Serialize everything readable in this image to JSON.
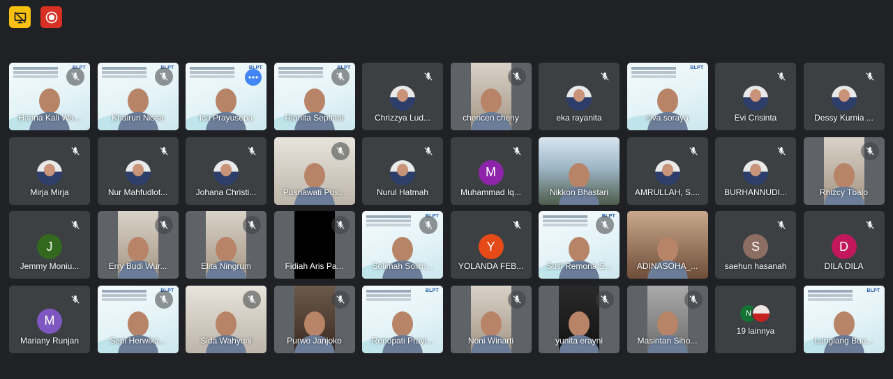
{
  "toolbar": {
    "present_icon": "presentation-off-icon",
    "record_icon": "recording-icon",
    "present_color": "#f9c00f",
    "record_color": "#d93025"
  },
  "colors": {
    "background": "#202124",
    "tile": "#3c4043",
    "active_border": "#8ab4f8"
  },
  "participants": [
    {
      "name": "Hanna Kali Wa...",
      "kind": "slide",
      "muted": true
    },
    {
      "name": "Khairun Nissa",
      "kind": "slide",
      "muted": true
    },
    {
      "name": "Ica Prayusepa",
      "kind": "slide",
      "muted": false,
      "active": true,
      "menu": true
    },
    {
      "name": "Rianita Septiani",
      "kind": "slide",
      "muted": true
    },
    {
      "name": "Chrizzya Lud...",
      "kind": "avatar-photo",
      "muted": true
    },
    {
      "name": "chencen cheny",
      "kind": "video-narrow",
      "muted": true
    },
    {
      "name": "eka rayanita",
      "kind": "avatar-photo",
      "muted": true
    },
    {
      "name": "siva soraya",
      "kind": "slide",
      "muted": false
    },
    {
      "name": "Evi Crisinta",
      "kind": "avatar-photo",
      "muted": true
    },
    {
      "name": "Dessy Kurnia ...",
      "kind": "avatar-photo",
      "muted": true
    },
    {
      "name": "Mirja Mirja",
      "kind": "avatar-photo",
      "muted": true
    },
    {
      "name": "Nur Mahfudlot...",
      "kind": "avatar-photo",
      "muted": true
    },
    {
      "name": "Johana Christi...",
      "kind": "avatar-photo",
      "muted": true
    },
    {
      "name": "Pusnawati Pus...",
      "kind": "video-room",
      "muted": true
    },
    {
      "name": "Nurul Hatmah",
      "kind": "avatar-photo",
      "muted": true
    },
    {
      "name": "Muhammad Iq...",
      "kind": "avatar-letter",
      "letter": "M",
      "color": "#8e24aa",
      "muted": true
    },
    {
      "name": "Nikkon Bhastari",
      "kind": "video-outdoor",
      "muted": false
    },
    {
      "name": "AMRULLAH, S....",
      "kind": "avatar-photo",
      "muted": true
    },
    {
      "name": "BURHANNUDI...",
      "kind": "avatar-photo",
      "muted": true
    },
    {
      "name": "Rhizcy Tbalo",
      "kind": "video-narrow",
      "muted": true
    },
    {
      "name": "Jemmy Moniu...",
      "kind": "avatar-letter",
      "letter": "J",
      "color": "#33691e",
      "muted": true
    },
    {
      "name": "Erry Budi Wur...",
      "kind": "video-narrow",
      "muted": true
    },
    {
      "name": "Elita Ningrum",
      "kind": "video-narrow",
      "muted": true
    },
    {
      "name": "Fidiah Aris Pa...",
      "kind": "video-black",
      "muted": true
    },
    {
      "name": "Solimah Solim...",
      "kind": "slide",
      "muted": true
    },
    {
      "name": "YOLANDA FEB...",
      "kind": "avatar-letter",
      "letter": "Y",
      "color": "#e64a19",
      "muted": true
    },
    {
      "name": "Susi Remona S...",
      "kind": "slide",
      "muted": true
    },
    {
      "name": "ADINASOHA_...",
      "kind": "video-warm",
      "muted": false
    },
    {
      "name": "saehun hasanah",
      "kind": "avatar-letter",
      "letter": "S",
      "color": "#8d6e63",
      "muted": true
    },
    {
      "name": "DILA DILA",
      "kind": "avatar-letter",
      "letter": "D",
      "color": "#c2185b",
      "muted": true
    },
    {
      "name": "Mariany Runjan",
      "kind": "avatar-letter",
      "letter": "M",
      "color": "#7e57c2",
      "muted": true
    },
    {
      "name": "Sepi Herwika...",
      "kind": "slide",
      "muted": true
    },
    {
      "name": "Sida Wahyuni",
      "kind": "video-room",
      "muted": true
    },
    {
      "name": "Purwo Janjoko",
      "kind": "video-warmy",
      "muted": true
    },
    {
      "name": "Renopati Prayi...",
      "kind": "slide",
      "muted": false
    },
    {
      "name": "Noni Winarti",
      "kind": "video-narrow",
      "muted": true
    },
    {
      "name": "yunita erayni",
      "kind": "video-dim",
      "muted": true
    },
    {
      "name": "Masintan Siho...",
      "kind": "video-grey",
      "muted": true
    },
    {
      "name": "19 lainnya",
      "kind": "more",
      "letter": "N"
    },
    {
      "name": "Langlang Bua...",
      "kind": "slide",
      "muted": false
    }
  ],
  "slide_logo": "BLPT"
}
